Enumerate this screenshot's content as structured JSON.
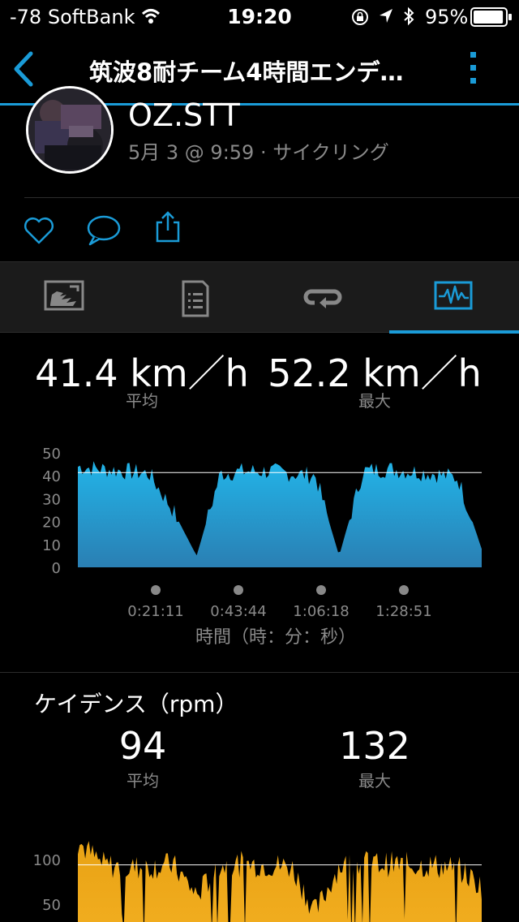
{
  "status_bar": {
    "carrier": "-78 SoftBank",
    "time": "19:20",
    "battery_percent": "95%",
    "battery_level": 0.95
  },
  "nav": {
    "title": "筑波8耐チーム4時間エンデ…"
  },
  "profile": {
    "name": "OZ.STT",
    "subtitle": "5月 3 @ 9:59 · サイクリング"
  },
  "tabs": [
    {
      "icon": "map-icon"
    },
    {
      "icon": "document-list-icon"
    },
    {
      "icon": "laps-icon"
    },
    {
      "icon": "chart-icon",
      "selected": true
    }
  ],
  "speed": {
    "avg_value": "41.4 km／h",
    "avg_label": "平均",
    "max_value": "52.2 km／h",
    "max_label": "最大"
  },
  "speed_chart_labels": {
    "x_ticks": [
      "0:21:11",
      "0:43:44",
      "1:06:18",
      "1:28:51"
    ],
    "xlabel": "時間（時：分：秒）"
  },
  "cadence": {
    "title": "ケイデンス（rpm）",
    "avg_value": "94",
    "avg_label": "平均",
    "max_value": "132",
    "max_label": "最大"
  },
  "chart_data": [
    {
      "type": "area",
      "ylim": [
        0,
        50
      ],
      "y_ticks": [
        "50",
        "40",
        "30",
        "20",
        "10",
        "0"
      ],
      "x": [
        "0:00:00",
        "0:10:00",
        "0:20:00",
        "0:30:00",
        "0:33:00",
        "0:35:00",
        "0:40:00",
        "0:50:00",
        "0:60:00",
        "1:00:00",
        "1:10:00",
        "1:12:00",
        "1:14:00",
        "1:20:00",
        "1:30:00",
        "1:40:00",
        "1:46:00",
        "1:48:00"
      ],
      "values": [
        44,
        43,
        42,
        41,
        25,
        5,
        41,
        42,
        42,
        41,
        40,
        5,
        42,
        43,
        42,
        41,
        39,
        8
      ],
      "reference_line": 41.4,
      "color": "#1fa8dc"
    },
    {
      "type": "area",
      "ylim": [
        0,
        132
      ],
      "y_ticks": [
        "100",
        "50"
      ],
      "values": [
        120,
        95,
        90,
        92,
        94,
        60,
        93,
        95,
        94,
        92,
        40,
        93,
        96,
        95,
        94,
        93,
        90,
        70
      ],
      "reference_line": 94,
      "color": "#f0a20b"
    }
  ],
  "colors": {
    "accent": "#1a9bd7",
    "speed_area": "#1fa8dc",
    "cadence_area": "#f0a20b"
  }
}
